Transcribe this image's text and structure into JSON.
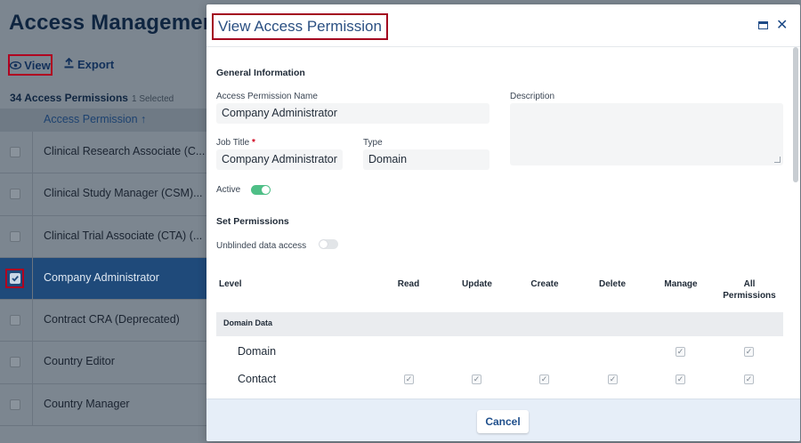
{
  "background": {
    "title": "Access Management",
    "toolbar": {
      "view_label": "View",
      "export_label": "Export"
    },
    "count_label": "34 Access Permissions",
    "selected_label": "1 Selected",
    "column_header": "Access Permission ↑",
    "rows": [
      {
        "label": "Clinical Research Associate (C...",
        "selected": false
      },
      {
        "label": "Clinical Study Manager (CSM)...",
        "selected": false
      },
      {
        "label": "Clinical Trial Associate (CTA) (...",
        "selected": false
      },
      {
        "label": "Company Administrator",
        "selected": true
      },
      {
        "label": "Contract CRA (Deprecated)",
        "selected": false
      },
      {
        "label": "Country Editor",
        "selected": false
      },
      {
        "label": "Country Manager",
        "selected": false
      }
    ]
  },
  "modal": {
    "title": "View Access Permission",
    "general_info_title": "General Information",
    "name_label": "Access Permission Name",
    "name_value": "Company Administrator",
    "description_label": "Description",
    "description_value": "",
    "job_title_label": "Job Title",
    "required_mark": "*",
    "job_title_value": "Company Administrator",
    "type_label": "Type",
    "type_value": "Domain",
    "active_label": "Active",
    "active_on": true,
    "set_permissions_title": "Set Permissions",
    "unblinded_label": "Unblinded data access",
    "unblinded_on": false,
    "permissions_table": {
      "headers": [
        "Level",
        "Read",
        "Update",
        "Create",
        "Delete",
        "Manage",
        "All Permissions"
      ],
      "header_all_line1": "All",
      "header_all_line2": "Permissions",
      "group": "Domain Data",
      "rows": [
        {
          "label": "Domain",
          "read": false,
          "update": false,
          "create": false,
          "delete": false,
          "manage": true,
          "all": true
        },
        {
          "label": "Contact",
          "read": true,
          "update": true,
          "create": true,
          "delete": true,
          "manage": true,
          "all": true
        }
      ]
    },
    "cancel_label": "Cancel"
  }
}
